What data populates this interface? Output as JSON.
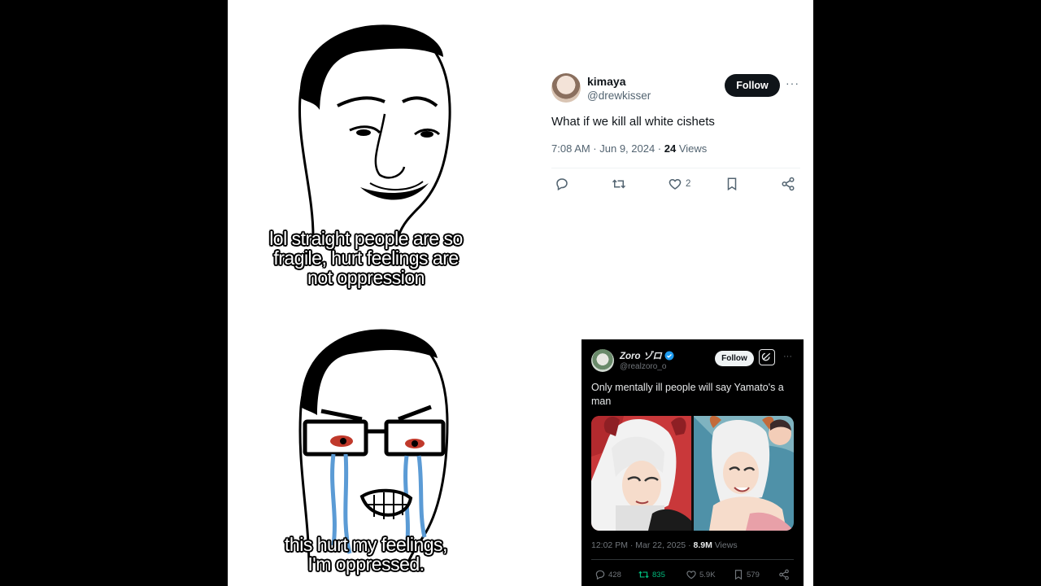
{
  "meme": {
    "top_caption": [
      "lol straight people are so",
      "fragile, hurt feelings are",
      "not oppression"
    ],
    "bottom_caption": [
      "this hurt my feelings,",
      "I'm oppressed."
    ]
  },
  "tweet1": {
    "display_name": "kimaya",
    "handle": "@drewkisser",
    "follow_label": "Follow",
    "more": "···",
    "text": "What if we kill all white cishets",
    "timestamp": "7:08 AM · Jun 9, 2024 · ",
    "views_count": "24",
    "views_label": " Views",
    "likes": "2",
    "icons": [
      "reply-icon",
      "retweet-icon",
      "like-icon",
      "bookmark-icon",
      "share-icon"
    ]
  },
  "tweet2": {
    "display_name": "Zoro ゾロ",
    "handle": "@realzoro_o",
    "follow_label": "Follow",
    "more": "···",
    "text": "Only mentally ill people will say Yamato's a man",
    "timestamp": "12:02 PM · Mar 22, 2025 · ",
    "views_count": "8.9M",
    "views_label": " Views",
    "replies": "428",
    "retweets": "835",
    "likes": "5.9K",
    "bookmarks": "579",
    "colors": {
      "verified": "#1d9bf0",
      "retweet_active": "#00ba7c"
    }
  }
}
